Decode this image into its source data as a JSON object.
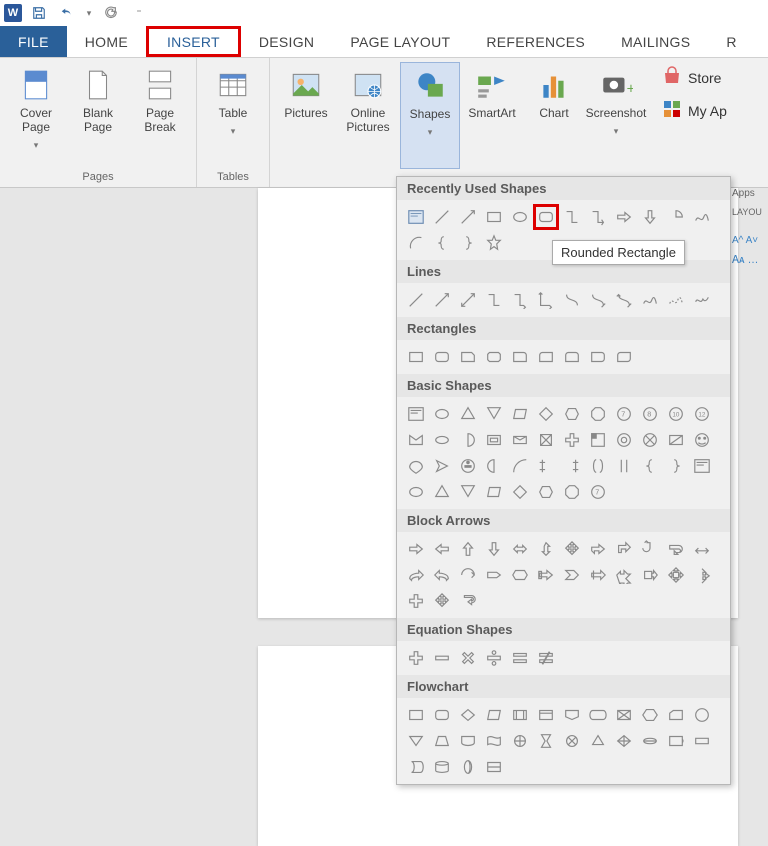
{
  "tabs": {
    "file": "FILE",
    "home": "HOME",
    "insert": "INSERT",
    "design": "DESIGN",
    "page_layout": "PAGE LAYOUT",
    "references": "REFERENCES",
    "mailings": "MAILINGS",
    "r": "R"
  },
  "ribbon": {
    "pages": {
      "label": "Pages",
      "cover": "Cover Page",
      "blank": "Blank Page",
      "pbreak": "Page Break"
    },
    "tables": {
      "label": "Tables",
      "table": "Table"
    },
    "illustrations": {
      "pictures": "Pictures",
      "online": "Online Pictures",
      "shapes": "Shapes",
      "smartart": "SmartArt",
      "chart": "Chart",
      "screenshot": "Screenshot"
    },
    "store": {
      "store": "Store",
      "myapps": "My Ap"
    }
  },
  "shapes_dd": {
    "recent": "Recently Used Shapes",
    "lines": "Lines",
    "rects": "Rectangles",
    "basic": "Basic Shapes",
    "arrows": "Block Arrows",
    "eq": "Equation Shapes",
    "flow": "Flowchart"
  },
  "tooltip": "Rounded Rectangle",
  "right_clip": {
    "apps": "Apps",
    "layout": "LAYOU"
  }
}
